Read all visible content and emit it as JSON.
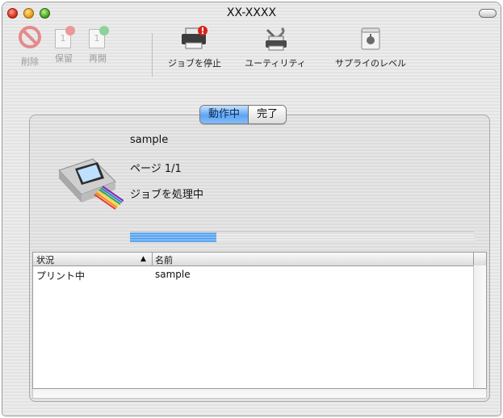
{
  "window": {
    "title": "XX-XXXX"
  },
  "toolbar": {
    "delete_label": "削除",
    "hold_label": "保留",
    "resume_label": "再開",
    "stop_jobs_label": "ジョブを停止",
    "utility_label": "ユーティリティ",
    "supply_levels_label": "サプライのレベル"
  },
  "tabs": {
    "active_label": "動作中",
    "completed_label": "完了"
  },
  "job": {
    "name": "sample",
    "page": "ページ 1/1",
    "status": "ジョブを処理中",
    "progress_fraction": 0.25
  },
  "table": {
    "columns": [
      "状況",
      "名前"
    ],
    "sort_indicator": "▲",
    "rows": [
      {
        "status": "プリント中",
        "name": "sample"
      }
    ]
  },
  "colors": {
    "accent": "#5fa4f2",
    "badge_red": "#d8241b",
    "badge_green": "#2fa44a"
  }
}
